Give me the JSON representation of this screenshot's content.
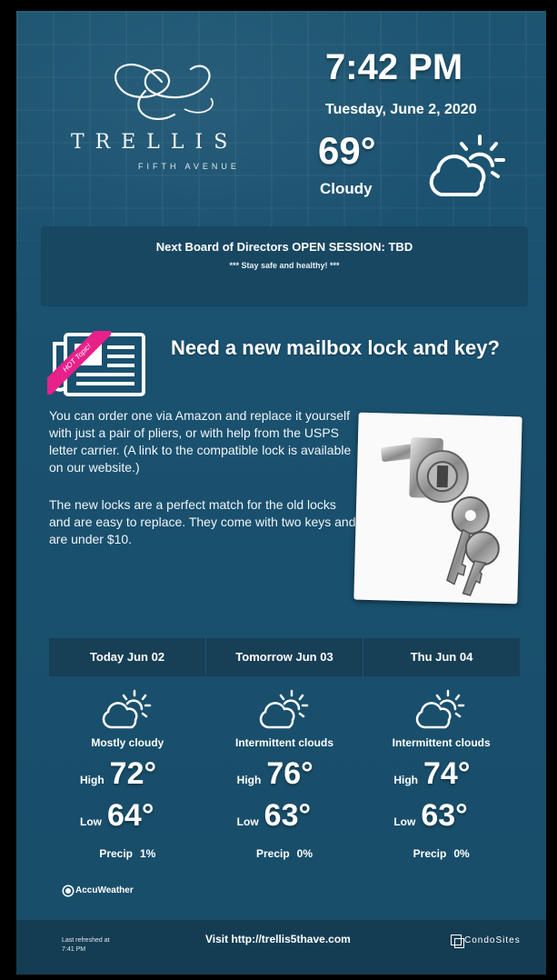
{
  "header": {
    "logo_name": "TRELLIS",
    "logo_sub": "FIFTH AVENUE",
    "time": "7:42 PM",
    "date": "Tuesday, June 2, 2020",
    "temperature": "69°",
    "condition": "Cloudy",
    "condition_icon": "partly-cloudy-icon"
  },
  "announcement": {
    "title": "Next Board of Directors OPEN SESSION: TBD",
    "subtitle": "*** Stay safe and healthy! ***"
  },
  "article": {
    "badge": "HOT Topic!",
    "icon": "newspaper-icon",
    "title": "Need a new mailbox lock and key?",
    "paragraph1": "You can order one via Amazon and replace it yourself with just a pair of pliers, or with help from the USPS letter carrier. (A link to the compatible lock is available on our website.)",
    "paragraph2": "The new locks are a perfect match for the old locks and are easy to replace. They come with two keys and are under $10."
  },
  "forecast": {
    "days": [
      {
        "label": "Today Jun 02",
        "desc": "Mostly cloudy",
        "high_label": "High",
        "high": "72°",
        "low_label": "Low",
        "low": "64°",
        "precip_label": "Precip",
        "precip": "1%"
      },
      {
        "label": "Tomorrow Jun 03",
        "desc": "Intermittent clouds",
        "high_label": "High",
        "high": "76°",
        "low_label": "Low",
        "low": "63°",
        "precip_label": "Precip",
        "precip": "0%"
      },
      {
        "label": "Thu Jun 04",
        "desc": "Intermittent clouds",
        "high_label": "High",
        "high": "74°",
        "low_label": "Low",
        "low": "63°",
        "precip_label": "Precip",
        "precip": "0%"
      }
    ],
    "provider": "AccuWeather"
  },
  "footer": {
    "refresh_line1": "Last refreshed at",
    "refresh_line2": "7:41 PM",
    "visit": "Visit http://trellis5thave.com",
    "brand": "CondoSites"
  },
  "colors": {
    "background": "#1b5270",
    "panel": "#184762",
    "hot_badge": "#e8208a"
  }
}
